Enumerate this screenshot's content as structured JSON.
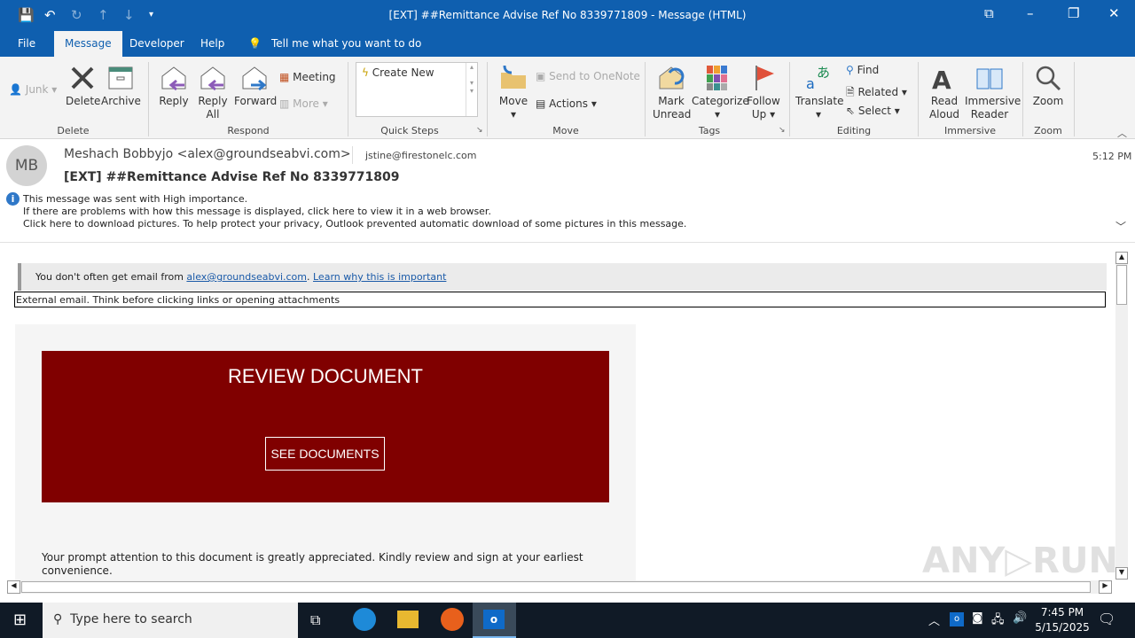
{
  "window": {
    "title": "[EXT] ##Remittance Advise Ref No 8339771809  -  Message (HTML)"
  },
  "menu": {
    "items": [
      "File",
      "Message",
      "Developer",
      "Help"
    ],
    "tell_me": "Tell me what you want to do"
  },
  "ribbon": {
    "junk": "Junk",
    "delete": "Delete",
    "archive": "Archive",
    "group_delete": "Delete",
    "reply": "Reply",
    "reply_all": "Reply All",
    "forward": "Forward",
    "meeting": "Meeting",
    "more": "More",
    "group_respond": "Respond",
    "create_new": "Create New",
    "group_quick_steps": "Quick Steps",
    "move": "Move",
    "send_onenote": "Send to OneNote",
    "actions": "Actions",
    "group_move": "Move",
    "mark_unread": "Mark Unread",
    "categorize": "Categorize",
    "follow_up": "Follow Up",
    "group_tags": "Tags",
    "translate": "Translate",
    "find": "Find",
    "related": "Related",
    "select": "Select",
    "group_editing": "Editing",
    "read_aloud": "Read Aloud",
    "immersive_reader": "Immersive Reader",
    "group_immersive": "Immersive",
    "zoom": "Zoom",
    "group_zoom": "Zoom"
  },
  "message": {
    "avatar_initials": "MB",
    "from": "Meshach Bobbyjo <alex@groundseabvi.com>",
    "to": "jstine@firestonelc.com",
    "time": "5:12 PM",
    "subject": "[EXT] ##Remittance Advise Ref No 8339771809",
    "info_lines": [
      "This message was sent with High importance.",
      "If there are problems with how this message is displayed, click here to view it in a web browser.",
      "Click here to download pictures. To help protect your privacy, Outlook prevented automatic download of some pictures in this message."
    ]
  },
  "body": {
    "notice_prefix": "You don't often get email from ",
    "notice_email": "alex@groundseabvi.com",
    "notice_sep": ". ",
    "notice_link": "Learn why this is important",
    "external_warning": "External email. Think before clicking links or opening attachments",
    "banner_title": "REVIEW DOCUMENT",
    "banner_button": "SEE DOCUMENTS",
    "banner_color": "#800000",
    "paragraph": "Your prompt attention to this document is greatly appreciated. Kindly review and sign at your earliest convenience."
  },
  "watermark": "ANY RUN",
  "taskbar": {
    "search_placeholder": "Type here to search",
    "time": "7:45 PM",
    "date": "5/15/2025"
  }
}
